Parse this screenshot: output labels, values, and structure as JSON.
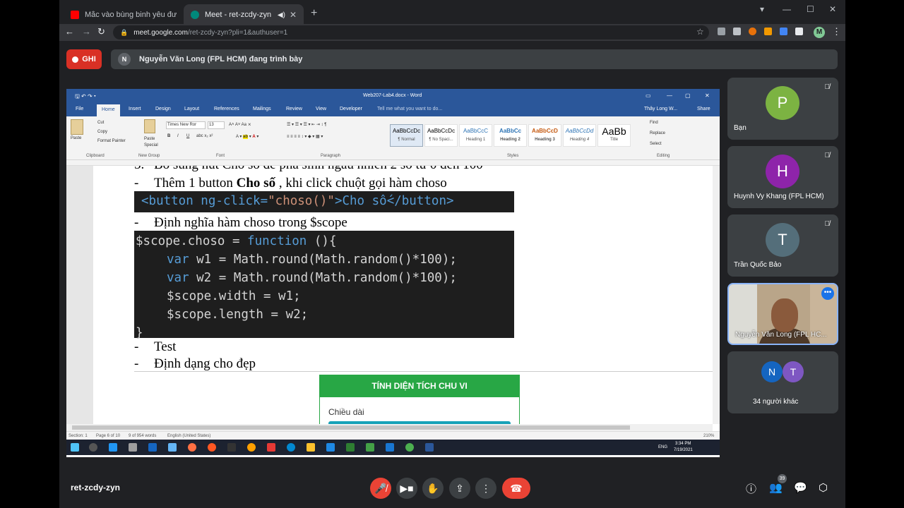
{
  "browser": {
    "tabs": [
      {
        "title": "Mắc vào bùng binh yêu đương",
        "favicon_color": "#ff0000"
      },
      {
        "title": "Meet - ret-zcdy-zyn",
        "favicon_color": "#00897b"
      }
    ],
    "url_host": "meet.google.com",
    "url_path": "/ret-zcdy-zyn?pli=1&authuser=1",
    "profile_initial": "M"
  },
  "meet": {
    "record_label": "GHI",
    "presenter_initial": "N",
    "presenting_text": "Nguyễn Văn Long (FPL HCM) đang trình bày",
    "meeting_code": "ret-zcdy-zyn",
    "people_count": "39",
    "participants": [
      {
        "initial": "P",
        "name": "Bạn",
        "color": "#7cb342"
      },
      {
        "initial": "H",
        "name": "Huynh Vy Khang (FPL HCM)",
        "color": "#8e24aa"
      },
      {
        "initial": "T",
        "name": "Trần Quốc Bảo",
        "color": "#546e7a"
      }
    ],
    "video_tile_name": "Nguyễn Văn Long (FPL HC...",
    "others": {
      "initials": [
        "N",
        "T"
      ],
      "colors": [
        "#1565c0",
        "#7e57c2"
      ],
      "label": "34 người khác"
    },
    "accent_end_call": "#ea4335"
  },
  "word": {
    "doc_title": "Web207-Lab4.docx - Word",
    "user": "Thây Long W...",
    "share": "Share",
    "tell_me": "Tell me what you want to do...",
    "menu": [
      "File",
      "Home",
      "Insert",
      "Design",
      "Layout",
      "References",
      "Mailings",
      "Review",
      "View",
      "Developer"
    ],
    "ribbon": {
      "paste": "Paste",
      "cut": "Cut",
      "copy": "Copy",
      "format_painter": "Format Painter",
      "paste_special": "Paste Special",
      "font_name": "Times New Ror",
      "font_size": "13",
      "groups": [
        "Clipboard",
        "New Group",
        "Font",
        "Paragraph",
        "Styles",
        "Editing"
      ],
      "styles": [
        {
          "sample": "AaBbCcDc",
          "name": "¶ Normal"
        },
        {
          "sample": "AaBbCcDc",
          "name": "¶ No Spaci..."
        },
        {
          "sample": "AaBbCcC",
          "name": "Heading 1"
        },
        {
          "sample": "AaBbCc",
          "name": "Heading 2"
        },
        {
          "sample": "AaBbCcD",
          "name": "Heading 3"
        },
        {
          "sample": "AaBbCcDd",
          "name": "Heading 4"
        },
        {
          "sample": "AaBb",
          "name": "Title"
        }
      ],
      "find": "Find",
      "replace": "Replace",
      "select": "Select"
    },
    "content": {
      "partial_line": "Bổ sung nút Cho số để phá sinh ngẫu nhiên 2 số từ 0 đến 100",
      "bullet1_pre": "Thêm 1 button ",
      "bullet1_bold": "Cho số",
      "bullet1_post": " , khi click chuột gọi hàm choso",
      "code1": {
        "t1": "<button ng-click=",
        "t2": "\"choso()\"",
        "t3": ">Cho số</button>"
      },
      "bullet2": "Định nghĩa hàm choso trong $scope",
      "code2_line1_a": "$scope.choso = ",
      "code2_line1_b": "function",
      "code2_line1_c": " (){",
      "code2_line2_kw": "var",
      "code2_line2_rest": " w1 = Math.round(Math.random()*100);",
      "code2_line3_kw": "var",
      "code2_line3_rest": " w2 = Math.round(Math.random()*100);",
      "code2_line4": "$scope.width = w1;",
      "code2_line5": "$scope.length = w2;",
      "code2_line6": "}",
      "bullet3": "Test",
      "bullet4": "Định dạng cho đẹp",
      "card_title": "TÍNH DIỆN TÍCH CHU VI",
      "card_label": "Chiều dài"
    },
    "status": {
      "section": "Section: 1",
      "page": "Page 6 of 10",
      "words": "9 of 954 words",
      "lang": "English (United States)",
      "zoom": "210%"
    },
    "taskbar": {
      "lang": "ENG",
      "time": "3:34 PM",
      "date": "7/19/2021"
    }
  }
}
